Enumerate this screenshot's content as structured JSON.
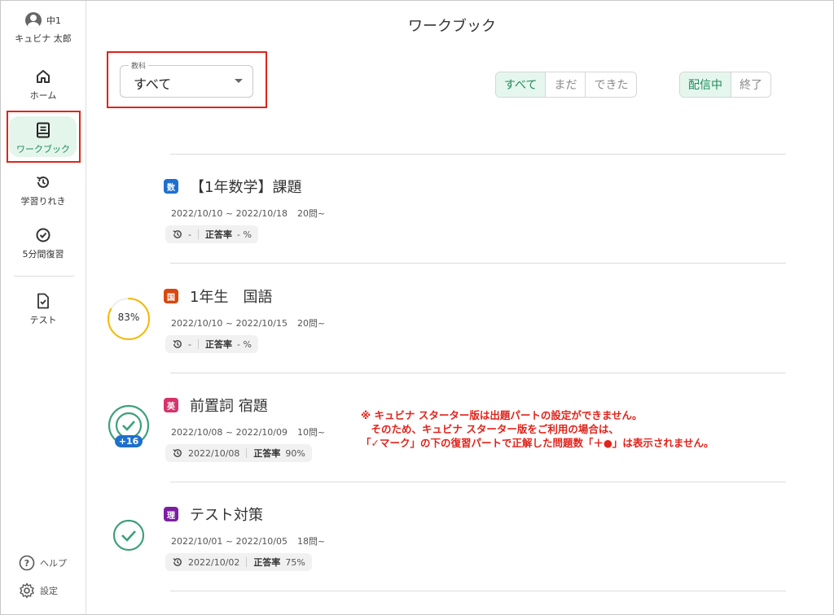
{
  "user": {
    "grade": "中1",
    "name": "キュビナ 太郎"
  },
  "nav": [
    {
      "label": "ホーム",
      "icon": "home-icon"
    },
    {
      "label": "ワークブック",
      "icon": "workbook-icon",
      "active": true
    },
    {
      "label": "学習りれき",
      "icon": "history-icon"
    },
    {
      "label": "5分間復習",
      "icon": "check-circle-icon"
    },
    {
      "label": "テスト",
      "icon": "test-document-icon"
    }
  ],
  "footer": {
    "help_label": "ヘルプ",
    "settings_label": "設定"
  },
  "header": {
    "title": "ワークブック"
  },
  "filter": {
    "subject_label": "教科",
    "subject_value": "すべて",
    "status": [
      "すべて",
      "まだ",
      "できた"
    ],
    "status_selected": "すべて",
    "delivery": [
      "配信中",
      "終了"
    ],
    "delivery_selected": "配信中"
  },
  "colors": {
    "accent": "#1f8a5c",
    "highlight": "#e2231a",
    "math": "#1e6fcf",
    "japanese": "#d9480f",
    "english": "#d6336c",
    "science": "#7b1fa2",
    "progress": "#f5b800"
  },
  "workbooks": [
    {
      "subject_tag": "数",
      "title": "【1年数学】課題",
      "period": "2022/10/10 ~ 2022/10/18",
      "questions": "20問~",
      "last_date": "-",
      "accuracy_label": "正答率",
      "accuracy": "- %",
      "progress": null,
      "completed": false,
      "bonus": null
    },
    {
      "subject_tag": "国",
      "title": "1年生　国語",
      "period": "2022/10/10 ~ 2022/10/15",
      "questions": "20問~",
      "last_date": "-",
      "accuracy_label": "正答率",
      "accuracy": "- %",
      "progress": "83%",
      "progress_value": 0.83,
      "completed": false,
      "bonus": null
    },
    {
      "subject_tag": "英",
      "title": "前置詞 宿題",
      "period": "2022/10/08 ~ 2022/10/09",
      "questions": "10問~",
      "last_date": "2022/10/08",
      "accuracy_label": "正答率",
      "accuracy": "90%",
      "progress": null,
      "completed": true,
      "bonus": "+16"
    },
    {
      "subject_tag": "理",
      "title": "テスト対策",
      "period": "2022/10/01 ~ 2022/10/05",
      "questions": "18問~",
      "last_date": "2022/10/02",
      "accuracy_label": "正答率",
      "accuracy": "75%",
      "progress": null,
      "completed": true,
      "bonus": null
    }
  ],
  "note": {
    "line1": "※ キュビナ スターター版は出題パートの設定ができません。",
    "line2": "　そのため、キュビナ スターター版をご利用の場合は、",
    "line3": "「✓マーク」の下の復習パートで正解した問題数「＋●」は表示されません。"
  }
}
